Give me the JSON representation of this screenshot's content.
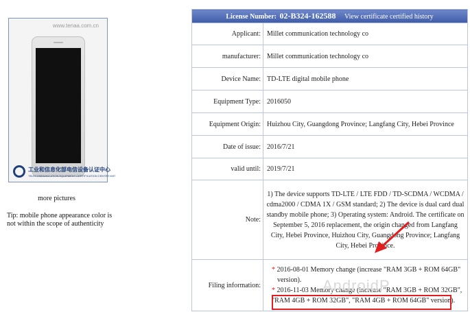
{
  "left_panel": {
    "watermark_url": "www.tenaa.com.cn",
    "logo_cn": "工业和信息化部电信设备认证中心",
    "logo_en": "TELECOMMUNICATION EQUIPMENT CERTIFICATION CENTER MIIT",
    "more_pictures": "more pictures",
    "tip": "Tip: mobile phone appearance color is not within the scope of authenticity"
  },
  "header": {
    "license_label": "License Number:",
    "license_number": "02-B324-162588",
    "history_link": "View certificate certified history"
  },
  "rows": [
    {
      "label": "Applicant:",
      "value": "Millet communication technology co"
    },
    {
      "label": "manufacturer:",
      "value": "Millet communication technology co"
    },
    {
      "label": "Device Name:",
      "value": "TD-LTE digital mobile phone"
    },
    {
      "label": "Equipment Type:",
      "value": "2016050"
    },
    {
      "label": "Equipment Origin:",
      "value": "Huizhou City, Guangdong Province; Langfang City, Hebei Province"
    },
    {
      "label": "Date of issue:",
      "value": "2016/7/21"
    },
    {
      "label": "valid until:",
      "value": "2019/7/21"
    }
  ],
  "note": {
    "label": "Note:",
    "value": "1) The device supports TD-LTE / LTE FDD / TD-SCDMA / WCDMA / cdma2000 / CDMA 1X / GSM standard; 2) The device is dual card dual standby mobile phone; 3) Operating system: Android. The certificate on September 5, 2016 replacement, the origin changed from Langfang City, Hebei Province, Huizhou City, Guangdong Province; Langfang City, Hebei Province."
  },
  "filing": {
    "label": "Filing information:",
    "star": "*",
    "entry1": "2016-08-01 Memory change (increase \"RAM 3GB + ROM 64GB\"",
    "entry1_cont": "version).",
    "entry2": "2016-11-03 Memory change (increase \"RAM 3GB + ROM 32GB\",",
    "entry2_cont": "\"RAM 4GB + ROM 32GB\", \"RAM 4GB + ROM 64GB\" version)."
  },
  "watermark": "AndroidP"
}
